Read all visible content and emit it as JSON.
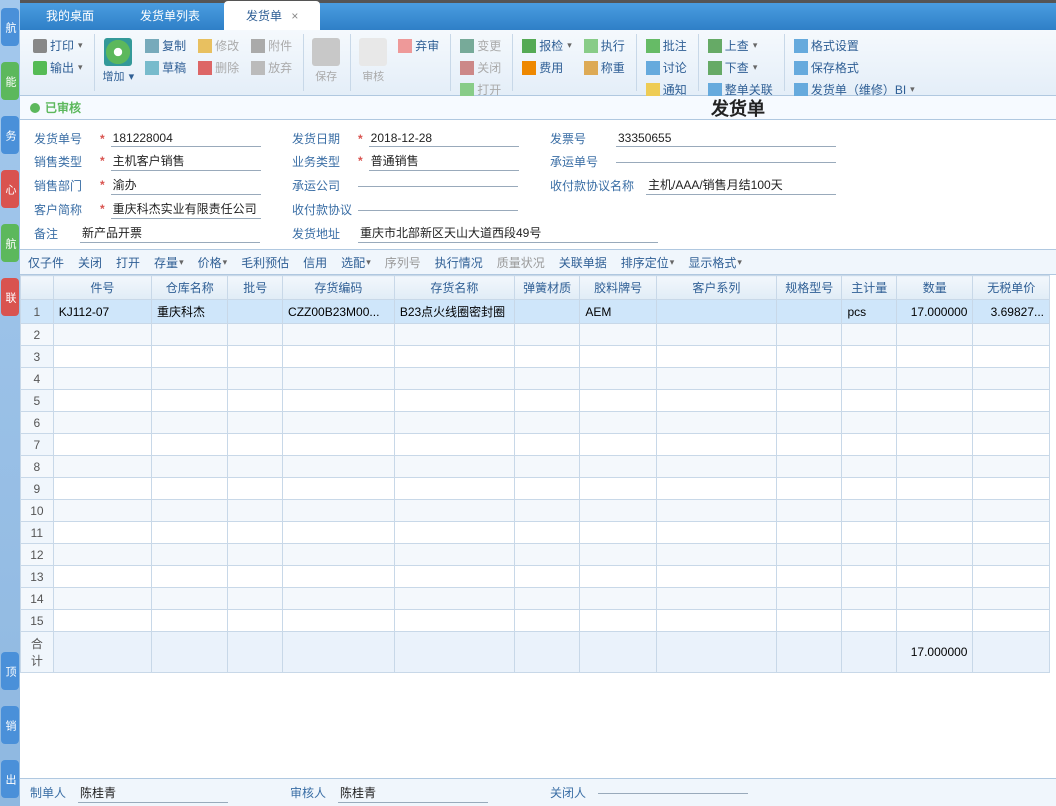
{
  "tabs": [
    {
      "label": "我的桌面",
      "active": false
    },
    {
      "label": "发货单列表",
      "active": false
    },
    {
      "label": "发货单",
      "active": true,
      "closable": true
    }
  ],
  "ribbon": {
    "print": "打印",
    "export": "输出",
    "add": "增加",
    "copy": "复制",
    "edit": "修改",
    "attach": "附件",
    "draft": "草稿",
    "delete": "删除",
    "abandon": "放弃",
    "save": "保存",
    "audit": "审核",
    "discard": "弃审",
    "change": "变更",
    "close": "关闭",
    "open": "打开",
    "inspect": "报检",
    "execute": "执行",
    "cost": "费用",
    "weigh": "称重",
    "approve": "批注",
    "discuss": "讨论",
    "notify": "通知",
    "up": "上查",
    "down": "下查",
    "assoc": "整单关联",
    "fmtset": "格式设置",
    "savefmt": "保存格式",
    "repair": "发货单（维修）BI"
  },
  "status": {
    "label": "已审核"
  },
  "docTitle": "发货单",
  "fields": {
    "shipNo": {
      "label": "发货单号",
      "val": "181228004"
    },
    "saleType": {
      "label": "销售类型",
      "val": "主机客户销售"
    },
    "saleDept": {
      "label": "销售部门",
      "val": "渝办"
    },
    "cust": {
      "label": "客户简称",
      "val": "重庆科杰实业有限责任公司"
    },
    "remark": {
      "label": "备注",
      "val": "新产品开票"
    },
    "shipDate": {
      "label": "发货日期",
      "val": "2018-12-28"
    },
    "bizType": {
      "label": "业务类型",
      "val": "普通销售"
    },
    "carrier": {
      "label": "承运公司",
      "val": ""
    },
    "payAgree": {
      "label": "收付款协议",
      "val": ""
    },
    "shipAddr": {
      "label": "发货地址",
      "val": "重庆市北部新区天山大道西段49号"
    },
    "invNo": {
      "label": "发票号",
      "val": "33350655"
    },
    "carrierNo": {
      "label": "承运单号",
      "val": ""
    },
    "payName": {
      "label": "收付款协议名称",
      "val": "主机/AAA/销售月结100天"
    }
  },
  "filters": [
    "仅子件",
    "关闭",
    "打开",
    "存量",
    "价格",
    "毛利预估",
    "信用",
    "选配",
    "序列号",
    "执行情况",
    "质量状况",
    "关联单据",
    "排序定位",
    "显示格式"
  ],
  "filtersDisabled": [
    8,
    10
  ],
  "filtersDropdown": [
    3,
    4,
    7,
    12,
    13
  ],
  "columns": [
    "",
    "件号",
    "仓库名称",
    "批号",
    "存货编码",
    "存货名称",
    "弹簧材质",
    "胶料牌号",
    "客户系列",
    "规格型号",
    "主计量",
    "数量",
    "无税单价"
  ],
  "row1": {
    "partNo": "KJ112-07",
    "wh": "重庆科杰",
    "batch": "",
    "code": "CZZ00B23M00...",
    "name": "B23点火线圈密封圈",
    "spring": "",
    "rubber": "AEM",
    "series": "",
    "spec": "",
    "uom": "pcs",
    "qty": "17.000000",
    "price": "3.69827..."
  },
  "totals": {
    "label": "合计",
    "qty": "17.000000"
  },
  "footer": {
    "maker": {
      "label": "制单人",
      "val": "陈桂青"
    },
    "auditor": {
      "label": "审核人",
      "val": "陈桂青"
    },
    "closer": {
      "label": "关闭人",
      "val": ""
    }
  }
}
